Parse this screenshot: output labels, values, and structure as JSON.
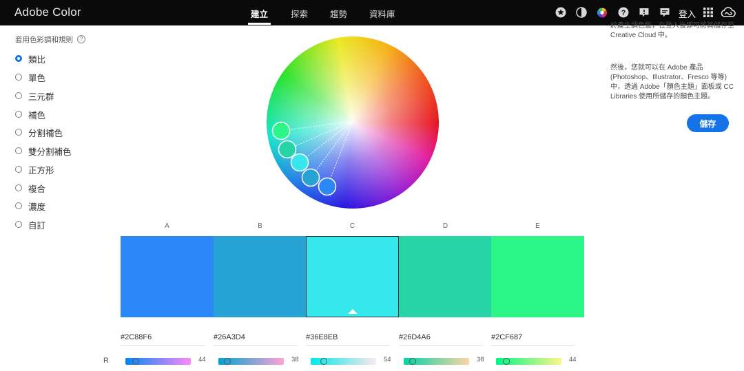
{
  "app": {
    "title": "Adobe Color"
  },
  "nav": [
    {
      "label": "建立",
      "active": true
    },
    {
      "label": "探索",
      "active": false
    },
    {
      "label": "趨勢",
      "active": false
    },
    {
      "label": "資料庫",
      "active": false
    }
  ],
  "header_icons": [
    "star-icon",
    "contrast-icon",
    "color-wheel-icon",
    "help-icon",
    "alert-icon",
    "chat-icon"
  ],
  "header": {
    "login_label": "登入",
    "apps_icon": "apps-grid-icon",
    "cc_icon": "creative-cloud-icon"
  },
  "rules": {
    "title": "套用色彩調和規則",
    "help_symbol": "?",
    "items": [
      {
        "label": "類比",
        "checked": true
      },
      {
        "label": "單色",
        "checked": false
      },
      {
        "label": "三元群",
        "checked": false
      },
      {
        "label": "補色",
        "checked": false
      },
      {
        "label": "分割補色",
        "checked": false
      },
      {
        "label": "雙分割補色",
        "checked": false
      },
      {
        "label": "正方形",
        "checked": false
      },
      {
        "label": "複合",
        "checked": false
      },
      {
        "label": "濃度",
        "checked": false
      },
      {
        "label": "自訂",
        "checked": false
      }
    ]
  },
  "info": {
    "para1": "色輪(或「顏色主題」)模組中的顏色可用於產生調色盤，在登入後即可將其儲存至 Creative Cloud 中。",
    "para2": "然後，您就可以在 Adobe 產品 (Photoshop、Illustrator、Fresco 等等) 中，透過 Adobe「顏色主題」面板或 CC Libraries 使用所儲存的顏色主題。"
  },
  "save_label": "儲存",
  "colors": {
    "accent": "#1473E6",
    "topbar": "#0A0A0A"
  },
  "swatches": [
    {
      "letter": "A",
      "hex": "#2C88F6",
      "selected": false,
      "r": 44
    },
    {
      "letter": "B",
      "hex": "#26A3D4",
      "selected": false,
      "r": 38
    },
    {
      "letter": "C",
      "hex": "#36E8EB",
      "selected": true,
      "r": 54
    },
    {
      "letter": "D",
      "hex": "#26D4A6",
      "selected": false,
      "r": 38
    },
    {
      "letter": "E",
      "hex": "#2CF687",
      "selected": false,
      "r": 44
    }
  ],
  "channel_label": "R"
}
